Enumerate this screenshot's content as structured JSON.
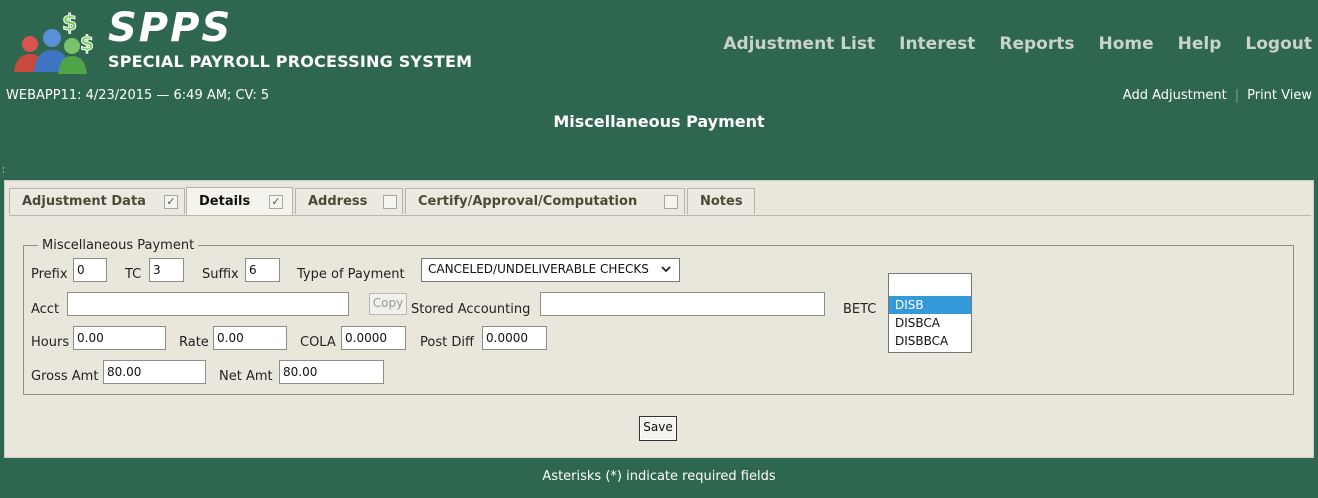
{
  "header": {
    "logo_title": "SPPS",
    "logo_subtitle": "SPECIAL PAYROLL PROCESSING SYSTEM",
    "nav": [
      "Adjustment List",
      "Interest",
      "Reports",
      "Home",
      "Help",
      "Logout"
    ]
  },
  "status_line": "WEBAPP11: 4/23/2015 — 6:49 AM; CV: 5",
  "links": {
    "add": "Add Adjustment",
    "print": "Print View"
  },
  "page_title": "Miscellaneous Payment",
  "tabs": [
    {
      "label": "Adjustment Data",
      "checked": true
    },
    {
      "label": "Details",
      "checked": true
    },
    {
      "label": "Address",
      "checked": false
    },
    {
      "label": "Certify/Approval/Computation",
      "checked": false
    },
    {
      "label": "Notes"
    }
  ],
  "form": {
    "legend": "Miscellaneous Payment",
    "prefix_label": "Prefix",
    "prefix": "0",
    "tc_label": "TC",
    "tc": "3",
    "suffix_label": "Suffix",
    "suffix": "6",
    "type_label": "Type of Payment",
    "type": "CANCELED/UNDELIVERABLE CHECKS",
    "acct_label": "Acct",
    "acct": "",
    "copy_label": "Copy",
    "stored_label": "Stored Accounting",
    "stored": "",
    "betc_label": "BETC",
    "betc_options": [
      "",
      "DISB",
      "DISBCA",
      "DISBBCA"
    ],
    "betc_selected": "DISB",
    "hours_label": "Hours",
    "hours": "0.00",
    "rate_label": "Rate",
    "rate": "0.00",
    "cola_label": "COLA",
    "cola": "0.0000",
    "postdiff_label": "Post Diff",
    "postdiff": "0.0000",
    "gross_label": "Gross Amt",
    "gross": "80.00",
    "net_label": "Net Amt",
    "net": "80.00"
  },
  "save_label": "Save",
  "footer": "Asterisks (*) indicate required fields",
  "colors": {
    "background": "#2f6650",
    "panel": "#e9e7dc",
    "selected": "#3399d9"
  }
}
